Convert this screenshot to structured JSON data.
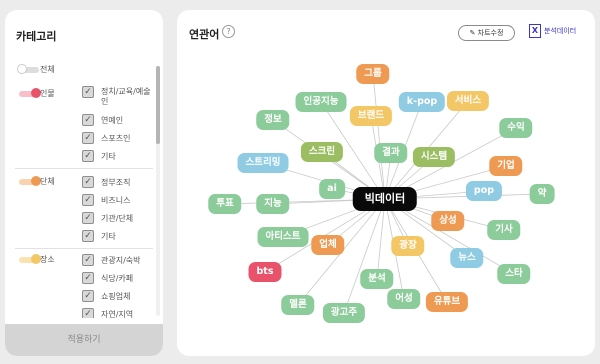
{
  "category_panel": {
    "title": "카테고리",
    "all_label": "전체",
    "groups": [
      {
        "label": "인물",
        "color": "#e8526a",
        "items": [
          "정치/교육/예술인",
          "연예인",
          "스포츠인",
          "기타"
        ]
      },
      {
        "label": "단체",
        "color": "#ef9a52",
        "items": [
          "정부조직",
          "비즈니스",
          "기관/단체",
          "기타"
        ]
      },
      {
        "label": "장소",
        "color": "#f3c766",
        "items": [
          "관광지/숙박",
          "식당/카페",
          "쇼핑업체",
          "자연/지역"
        ]
      }
    ],
    "apply_label": "적용하기"
  },
  "related_panel": {
    "title": "연관어",
    "help": "?",
    "edit_chart_label": "차트수정",
    "excel_icon": "X",
    "download_label": "분석데이터",
    "center_word": "빅데이터",
    "words": [
      "그룹",
      "k-pop",
      "서비스",
      "인공지능",
      "브랜드",
      "정보",
      "수익",
      "스크린",
      "결과",
      "시스템",
      "스트리밍",
      "기업",
      "ai",
      "pop",
      "약",
      "투표",
      "지능",
      "상성",
      "기사",
      "아티스트",
      "업체",
      "광장",
      "뉴스",
      "bts",
      "스타",
      "분석",
      "멜론",
      "어성",
      "유튜브",
      "광고주"
    ]
  }
}
